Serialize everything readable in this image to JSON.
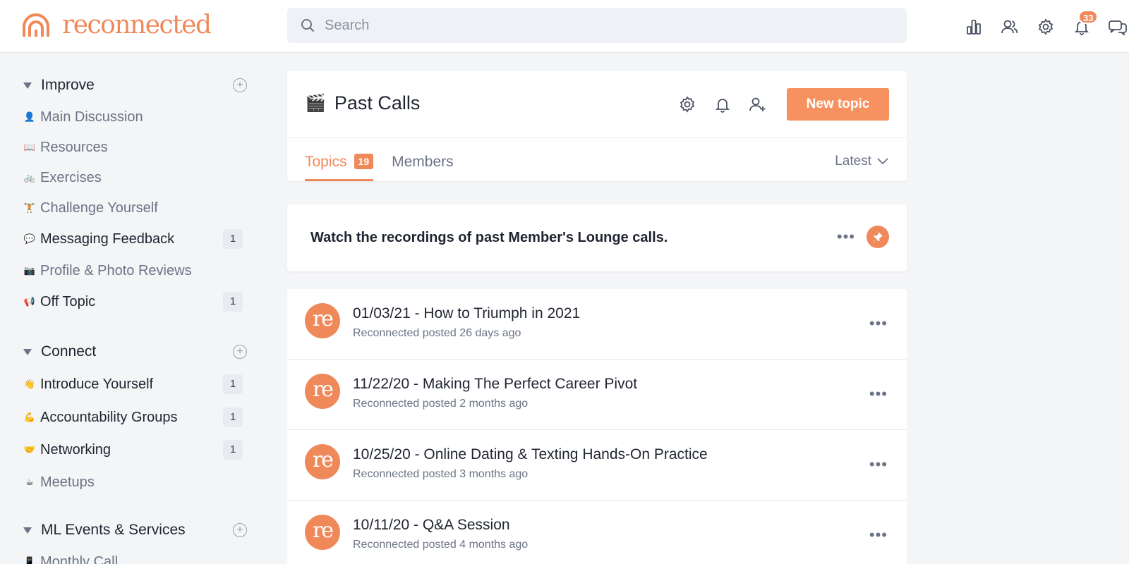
{
  "header": {
    "brand": "reconnected",
    "search_placeholder": "Search",
    "notifications_count": "33",
    "icons": [
      "analytics-icon",
      "users-icon",
      "settings-icon",
      "bell-icon",
      "chat-icon"
    ]
  },
  "colors": {
    "accent": "#f0895a",
    "button": "#f7915f"
  },
  "sidebar": {
    "sections": [
      {
        "title": "Improve",
        "items": [
          {
            "emoji": "👤",
            "label": "Main Discussion",
            "count": ""
          },
          {
            "emoji": "📖",
            "label": "Resources",
            "count": ""
          },
          {
            "emoji": "🚲",
            "label": "Exercises",
            "count": ""
          },
          {
            "emoji": "🏋",
            "label": "Challenge Yourself",
            "count": ""
          },
          {
            "emoji": "💬",
            "label": "Messaging Feedback",
            "count": "1"
          },
          {
            "emoji": "📷",
            "label": "Profile & Photo Reviews",
            "count": ""
          },
          {
            "emoji": "📢",
            "label": "Off Topic",
            "count": "1"
          }
        ]
      },
      {
        "title": "Connect",
        "items": [
          {
            "emoji": "👋",
            "label": "Introduce Yourself",
            "count": "1"
          },
          {
            "emoji": "💪",
            "label": "Accountability Groups",
            "count": "1"
          },
          {
            "emoji": "🤝",
            "label": "Networking",
            "count": "1"
          },
          {
            "emoji": "☕",
            "label": "Meetups",
            "count": ""
          }
        ]
      },
      {
        "title": "ML Events & Services",
        "items": [
          {
            "emoji": "📱",
            "label": "Monthly Call",
            "count": ""
          }
        ]
      }
    ]
  },
  "category": {
    "emoji": "🎬",
    "title": "Past Calls",
    "new_topic_label": "New topic",
    "tabs": [
      {
        "label": "Topics",
        "count": "19"
      },
      {
        "label": "Members"
      }
    ],
    "sort_label": "Latest",
    "description": "Watch the recordings of past Member's Lounge calls."
  },
  "topics": [
    {
      "avatar": "re",
      "title": "01/03/21 - How to Triumph in 2021",
      "meta": "Reconnected posted 26 days ago"
    },
    {
      "avatar": "re",
      "title": "11/22/20 - Making The Perfect Career Pivot",
      "meta": "Reconnected posted 2 months ago"
    },
    {
      "avatar": "re",
      "title": "10/25/20 - Online Dating & Texting Hands-On Practice",
      "meta": "Reconnected posted 3 months ago"
    },
    {
      "avatar": "re",
      "title": "10/11/20 - Q&A Session",
      "meta": "Reconnected posted 4 months ago"
    }
  ]
}
